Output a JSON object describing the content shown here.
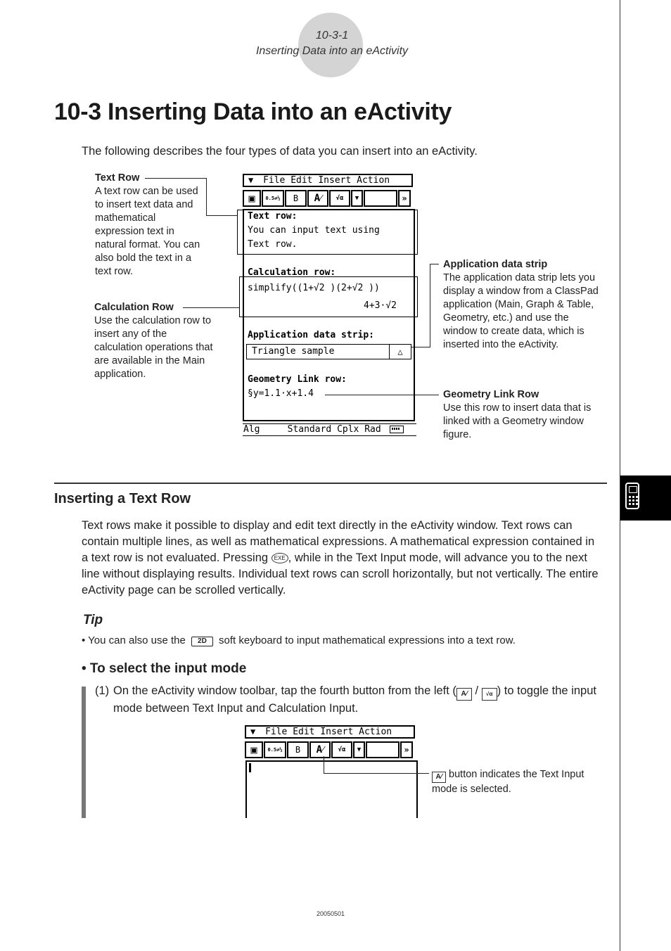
{
  "header": {
    "section_number": "10-3-1",
    "section_title": "Inserting Data into an eActivity"
  },
  "page_title": "10-3 Inserting Data into an eActivity",
  "intro": "The following describes the four types of data you can insert into an eActivity.",
  "callouts": {
    "text_row": {
      "title": "Text Row",
      "body": "A text row can be used to insert text data and mathematical expression text in natural format. You can also bold the text in a text row."
    },
    "calculation_row": {
      "title": "Calculation Row",
      "body": "Use the calculation row to insert any of the calculation operations that are available in the Main application."
    },
    "application_data_strip": {
      "title": "Application data strip",
      "body": "The application data strip lets you display a window from a ClassPad application (Main, Graph & Table, Geometry, etc.) and use the window to create data, which is inserted into the eActivity."
    },
    "geometry_link_row": {
      "title": "Geometry Link Row",
      "body": "Use this row to insert data that is linked with a Geometry window figure."
    }
  },
  "calculator": {
    "menu_arrow": "▼",
    "menu_items": [
      "File",
      "Edit",
      "Insert",
      "Action"
    ],
    "toolbar": {
      "save": "▣",
      "convert": "0.5⇄½",
      "bold": "B",
      "text_mode": "A⁄",
      "calc_mode": "√α",
      "dropdown": "▼",
      "blank": "",
      "scroll_right": "»"
    },
    "rows": {
      "text_heading": "Text row:",
      "text_line1": "You can input text using",
      "text_line2": "Text row.",
      "calc_heading": "Calculation row:",
      "calc_input": "simplify((1+√2 )(2+√2 ))",
      "calc_result": "4+3·√2",
      "app_heading": "Application data strip:",
      "app_strip_label": "Triangle sample",
      "app_strip_icon": "△",
      "geo_heading": "Geometry Link row:",
      "geo_value": "§y=1.1·x+1.4"
    },
    "status": {
      "mode": "Alg",
      "format": "Standard",
      "complex": "Cplx",
      "angle": "Rad"
    }
  },
  "section": {
    "title": "Inserting a Text Row",
    "paragraph_part1": "Text rows make it possible to display and edit text directly in the eActivity window. Text rows can contain multiple lines, as well as mathematical expressions. A mathematical expression contained in a text row is not evaluated.  Pressing ",
    "exe_key": "EXE",
    "paragraph_part2": ", while in the Text Input mode, will advance you to the next line without displaying results.  Individual text rows can scroll horizontally, but not vertically. The entire eActivity page can be scrolled vertically."
  },
  "tip": {
    "title": "Tip",
    "before": "• You can also use the",
    "key": "2D",
    "after": "soft keyboard to input mathematical expressions into a text row."
  },
  "procedure": {
    "title": "• To select the input mode",
    "step_number": "(1)",
    "step_before": "On the eActivity window toolbar, tap the fourth button from the left (",
    "icon_text": "A⁄",
    "separator": " / ",
    "icon_calc": "√α",
    "step_after": ") to toggle the input mode between Text Input and Calculation Input.",
    "note_icon": "A⁄",
    "note": "button indicates the Text Input mode is selected."
  },
  "footer": "20050501"
}
